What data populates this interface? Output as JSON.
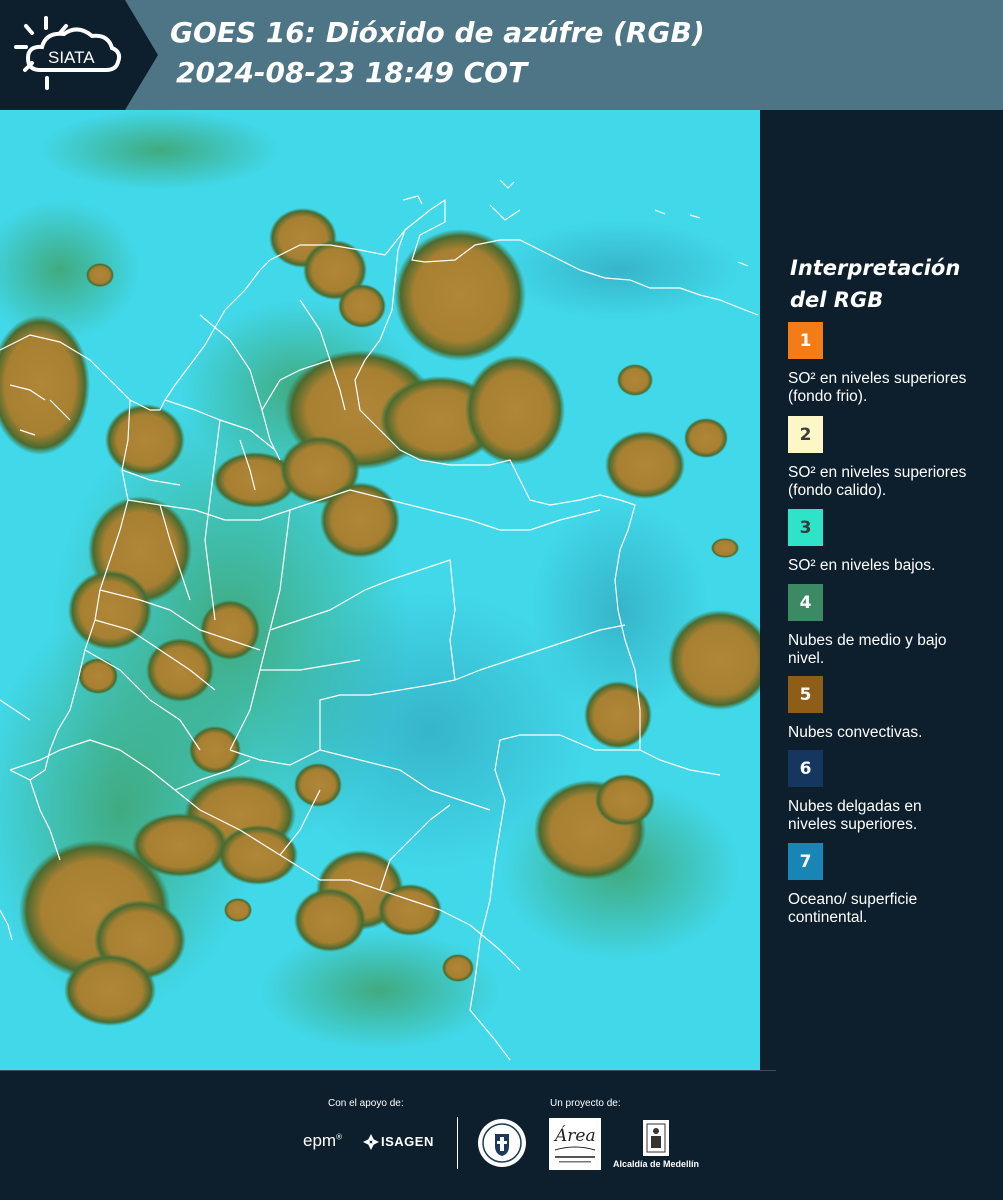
{
  "header": {
    "logo_text": "SIATA",
    "title_line1": "GOES 16: Dióxido de azúfre (RGB)",
    "title_line2": "2024-08-23 18:49 COT"
  },
  "legend": {
    "title": "Interpretación del RGB",
    "items": [
      {
        "number": "1",
        "color": "#f37c16",
        "text_color": "#ffffff",
        "label": "SO² en niveles superiores (fondo frio)."
      },
      {
        "number": "2",
        "color": "#fdf6c7",
        "text_color": "#3a3a3a",
        "label": "SO² en niveles superiores (fondo calido)."
      },
      {
        "number": "3",
        "color": "#2ee3c8",
        "text_color": "#3a3a3a",
        "label": "SO² en niveles bajos."
      },
      {
        "number": "4",
        "color": "#3c8a64",
        "text_color": "#ffffff",
        "label": "Nubes de medio y bajo nivel."
      },
      {
        "number": "5",
        "color": "#8e5d17",
        "text_color": "#ffffff",
        "label": "Nubes convectivas."
      },
      {
        "number": "6",
        "color": "#14365f",
        "text_color": "#ffffff",
        "label": "Nubes delgadas en niveles superiores."
      },
      {
        "number": "7",
        "color": "#1985b5",
        "text_color": "#ffffff",
        "label": "Oceano/ superficie continental."
      }
    ]
  },
  "map": {
    "background_color": "#41d8ea",
    "cloud_color": "#a98136",
    "border_color": "#ffffff"
  },
  "footer": {
    "support_label": "Con el apoyo de:",
    "project_label": "Un proyecto de:",
    "epm": "epm",
    "isagen": "ISAGEN",
    "area_metropolitana": "Área",
    "alcaldia": "Alcaldía de Medellín"
  }
}
